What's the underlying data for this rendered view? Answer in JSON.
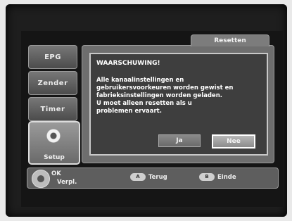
{
  "tabs": [
    {
      "label": "EPG"
    },
    {
      "label": "Zender"
    },
    {
      "label": "Timer"
    },
    {
      "label": "Setup"
    }
  ],
  "panel": {
    "title": "Resetten"
  },
  "dialog": {
    "title": "WAARSCHUWING!",
    "lines": [
      "Alle kanaalinstellingen en",
      "gebruikersvoorkeuren worden gewist en",
      "fabrieksinstellingen worden geladen.",
      "U moet alleen resetten als u",
      "problemen ervaart."
    ],
    "yes_label": "Ja",
    "no_label": "Nee",
    "selected": "Nee"
  },
  "hints": {
    "ok": "OK",
    "move": "Verpl.",
    "back_key": "A",
    "back": "Terug",
    "exit_key": "B",
    "exit": "Einde"
  },
  "icons": {
    "setup": "gear-icon",
    "navigation": "dpad-icon"
  }
}
